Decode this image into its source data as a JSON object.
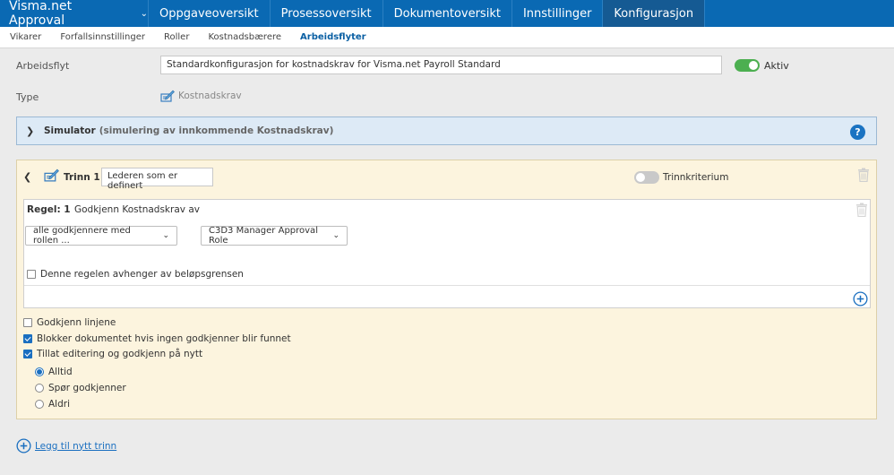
{
  "topnav": {
    "brand": "Visma.net Approval",
    "tabs": [
      {
        "label": "Oppgaveoversikt",
        "active": false
      },
      {
        "label": "Prosessoversikt",
        "active": false
      },
      {
        "label": "Dokumentoversikt",
        "active": false
      },
      {
        "label": "Innstillinger",
        "active": false
      },
      {
        "label": "Konfigurasjon",
        "active": true
      }
    ]
  },
  "subnav": {
    "items": [
      {
        "label": "Vikarer",
        "active": false
      },
      {
        "label": "Forfallsinnstillinger",
        "active": false
      },
      {
        "label": "Roller",
        "active": false
      },
      {
        "label": "Kostnadsbærere",
        "active": false
      },
      {
        "label": "Arbeidsflyter",
        "active": true
      }
    ]
  },
  "workflow": {
    "label": "Arbeidsflyt",
    "value": "Standardkonfigurasjon for kostnadskrav for Visma.net Payroll Standard",
    "active_label": "Aktiv",
    "active": true,
    "type_label": "Type",
    "type_value": "Kostnadskrav"
  },
  "simulator": {
    "title": "Simulator",
    "subtitle": "(simulering av innkommende Kostnadskrav)",
    "help": "?"
  },
  "step": {
    "label": "Trinn 1 :",
    "name": "Lederen som er definert",
    "criterion_label": "Trinnkriterium",
    "criterion_on": false,
    "rule": {
      "label": "Regel: 1",
      "description": "Godkjenn Kostnadskrav av",
      "approver_select": "alle godkjennere med rollen ...",
      "role_select": "C3D3 Manager Approval Role",
      "amount_check_label": "Denne regelen avhenger av beløpsgrensen",
      "amount_checked": false
    },
    "options": [
      {
        "label": "Godkjenn linjene",
        "checked": false
      },
      {
        "label": "Blokker dokumentet hvis ingen godkjenner blir funnet",
        "checked": true
      },
      {
        "label": "Tillat editering og godkjenn på nytt",
        "checked": true
      }
    ],
    "radios": [
      {
        "label": "Alltid",
        "checked": true
      },
      {
        "label": "Spør godkjenner",
        "checked": false
      },
      {
        "label": "Aldri",
        "checked": false
      }
    ]
  },
  "add_step_label": "Legg til nytt trinn",
  "colors": {
    "nav_bg": "#0a69b3",
    "nav_active": "#155a93",
    "accent": "#1a6fc0",
    "toggle_on": "#4caf50",
    "step_bg": "#fcf4de",
    "simulator_bg": "#ddeaf6"
  }
}
